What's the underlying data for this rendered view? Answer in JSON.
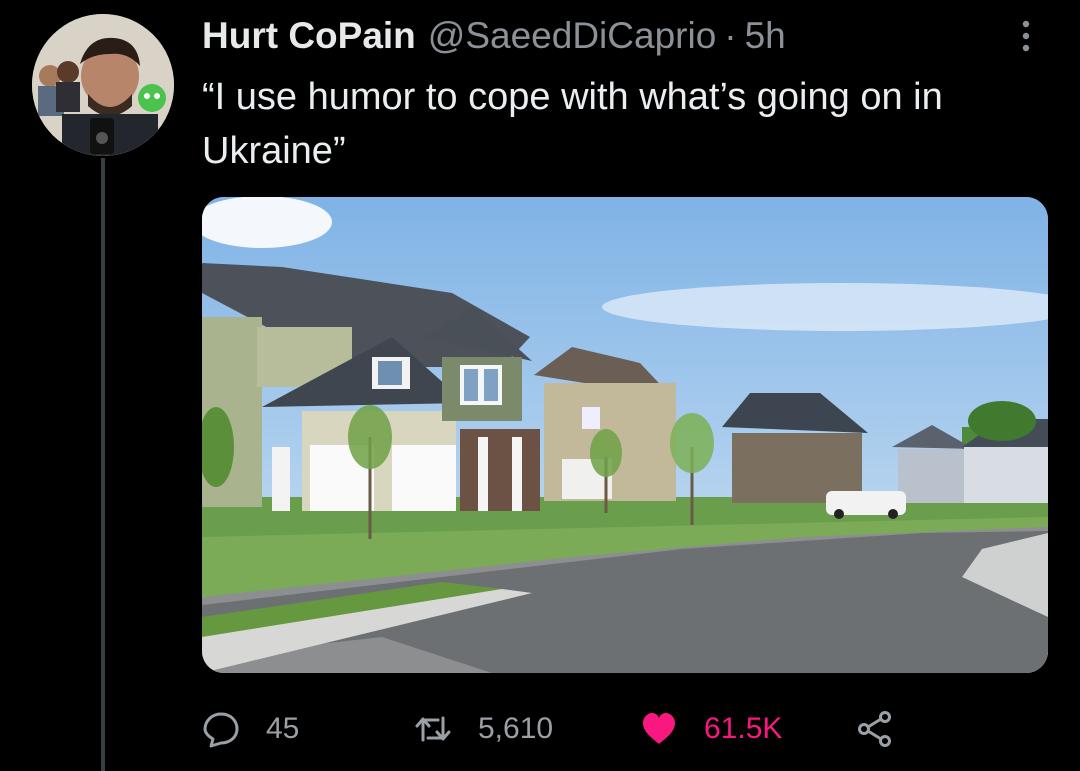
{
  "tweet": {
    "display_name": "Hurt CoPain",
    "handle": "@SaeedDiCaprio",
    "separator": "·",
    "time": "5h",
    "text": "“I use humor to cope with what’s going on in Ukraine”",
    "icons": {
      "more": "more-vertical-icon"
    }
  },
  "media": {
    "content": "photo of suburban street with houses"
  },
  "actions": {
    "reply": {
      "icon": "reply-icon",
      "count": "45"
    },
    "retweet": {
      "icon": "retweet-icon",
      "count": "5,610"
    },
    "like": {
      "icon": "heart-icon",
      "count": "61.5K",
      "active": true
    },
    "share": {
      "icon": "share-icon"
    }
  },
  "colors": {
    "background": "#000000",
    "text": "#e7e9ea",
    "muted": "#8b9197",
    "like": "#f91880",
    "thread_line": "#3a3f44"
  }
}
